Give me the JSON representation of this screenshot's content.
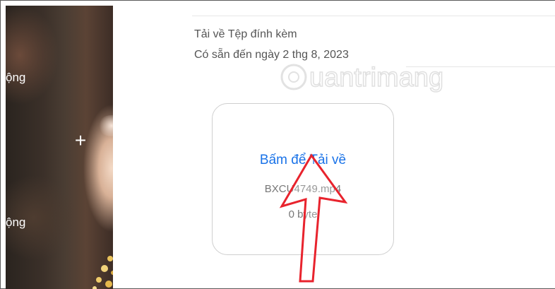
{
  "side": {
    "label_top": "ộng",
    "label_bottom": "ộng",
    "plus_symbol": "+"
  },
  "attachment": {
    "heading": "Tải về Tệp đính kèm",
    "expiry": "Có sẵn đến ngày 2 thg 8, 2023",
    "card": {
      "action_label": "Bấm để Tải về",
      "file_name": "BXCU4749.mp4",
      "file_size": "0 byte"
    }
  },
  "watermark": {
    "text": "uantrimang"
  },
  "colors": {
    "link": "#1a73e8",
    "arrow": "#e8232d",
    "text_muted": "#555555"
  },
  "icons": {
    "plus": "plus-icon",
    "annotation": "red-arrow-annotation"
  }
}
